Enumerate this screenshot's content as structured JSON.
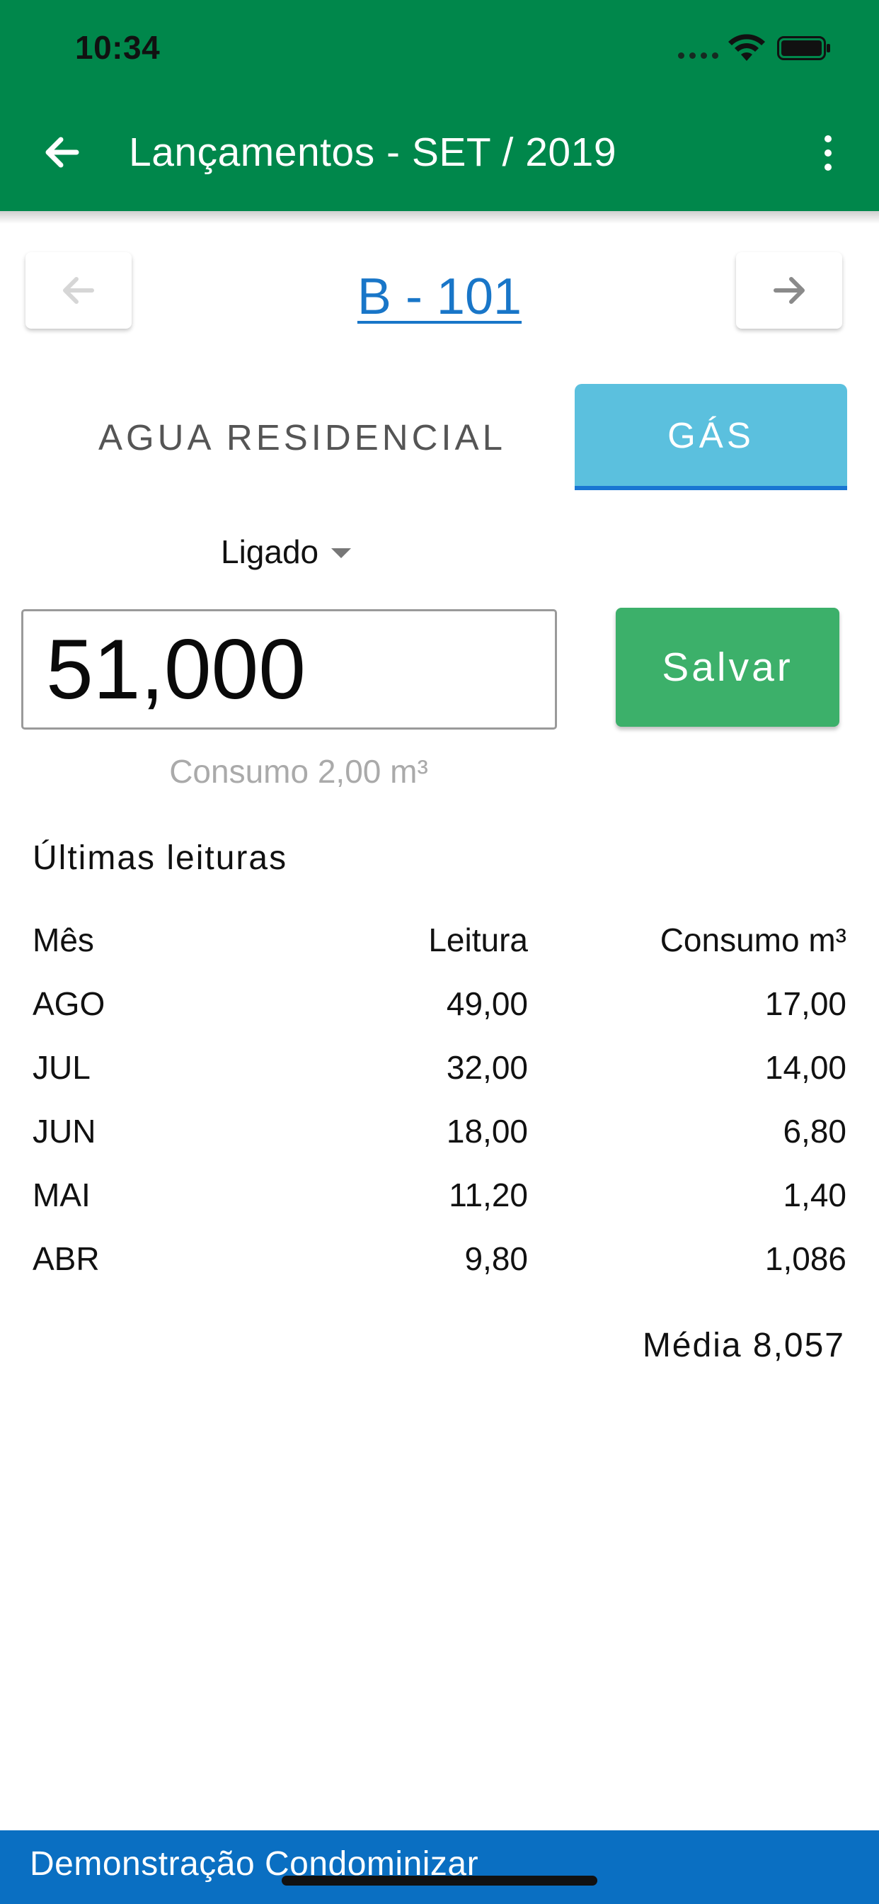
{
  "status_bar": {
    "time": "10:34"
  },
  "header": {
    "title": "Lançamentos - SET / 2019",
    "back_icon": "arrow-left-icon",
    "menu_icon": "more-vert-icon",
    "color": "#00874B"
  },
  "unit_nav": {
    "unit": "B - 101",
    "prev_icon": "arrow-left-icon",
    "next_icon": "arrow-right-icon"
  },
  "tabs": [
    {
      "label": "AGUA RESIDENCIAL",
      "selected": false
    },
    {
      "label": "GÁS",
      "selected": true
    }
  ],
  "status_dropdown": {
    "selected": "Ligado"
  },
  "reading": {
    "value": "51,000"
  },
  "save_button": {
    "label": "Salvar",
    "color": "#3CB06A"
  },
  "consumption_text": "Consumo 2,00 m³",
  "history": {
    "title": "Últimas leituras",
    "headers": {
      "mes": "Mês",
      "leitura": "Leitura",
      "consumo": "Consumo m³"
    },
    "rows": [
      {
        "mes": "AGO",
        "leitura": "49,00",
        "consumo": "17,00"
      },
      {
        "mes": "JUL",
        "leitura": "32,00",
        "consumo": "14,00"
      },
      {
        "mes": "JUN",
        "leitura": "18,00",
        "consumo": "6,80"
      },
      {
        "mes": "MAI",
        "leitura": "11,20",
        "consumo": "1,40"
      },
      {
        "mes": "ABR",
        "leitura": "9,80",
        "consumo": "1,086"
      }
    ],
    "media": "Média 8,057"
  },
  "footer": {
    "text": "Demonstração Condominizar",
    "color": "#0A6FC2"
  }
}
